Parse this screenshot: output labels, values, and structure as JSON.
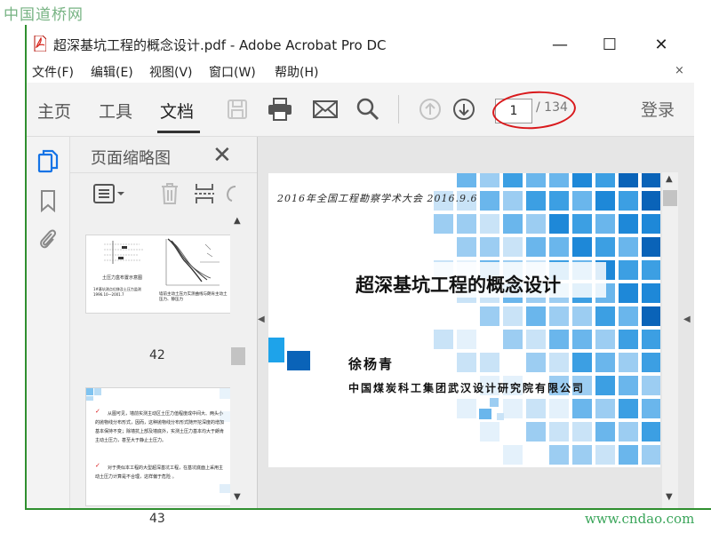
{
  "watermark": {
    "top": "中国道桥网",
    "bottom": "www.cndao.com"
  },
  "window": {
    "title": "超深基坑工程的概念设计.pdf - Adobe Acrobat Pro DC",
    "controls": {
      "minimize": "—",
      "maximize": "☐",
      "close": "✕"
    }
  },
  "menubar": {
    "items": [
      "文件(F)",
      "编辑(E)",
      "视图(V)",
      "窗口(W)",
      "帮助(H)"
    ],
    "close": "×"
  },
  "toolbar": {
    "tabs": [
      "主页",
      "工具",
      "文档"
    ],
    "active_tab": "文档",
    "page_current": "1",
    "page_total": "/ 134",
    "login": "登录",
    "icons": [
      "save-icon",
      "print-icon",
      "email-icon",
      "search-icon",
      "page-up-icon",
      "page-down-icon"
    ]
  },
  "left_rail": {
    "icons": [
      "page-thumbnails-icon",
      "bookmark-icon",
      "attachment-icon"
    ]
  },
  "thumbnail_panel": {
    "title": "页面缩略图",
    "close": "✕",
    "pages": [
      {
        "number": "42",
        "caption_left": "土压力盒布置示意图",
        "note_left": "1#基坑测点位移及土压力监测 1996.10—2001.7",
        "caption_right": "墙前主动土压力实测曲线与朗肯主动土压力、静压力"
      },
      {
        "number": "43",
        "lines": [
          "从图可见，墙前实测主动区土压力值程度成中间大、两头小的抛物线分布形式，因而，这种抛物线分布形式随开挖深度的增加基本保持不变；除墙抗上部及墙底外，实测土压力基本均大于朗肯主动土压力，甚至大于静止土压力。",
          "对于类似本工程的大型超深基坑工程，在基坑底面上采用主动土压力计算是不合理，这样偏于危险 。"
        ]
      }
    ]
  },
  "slide": {
    "date_line": "2016年全国工程勘察学术大会  2016.9.6",
    "title": "超深基坑工程的概念设计",
    "author": "徐杨青",
    "organization": "中国煤炭科工集团武汉设计研究院有限公司"
  },
  "colors": {
    "accent_red": "#d9191c",
    "tile_blue": "#1e88d8",
    "frame_green": "#2f8f2f"
  }
}
